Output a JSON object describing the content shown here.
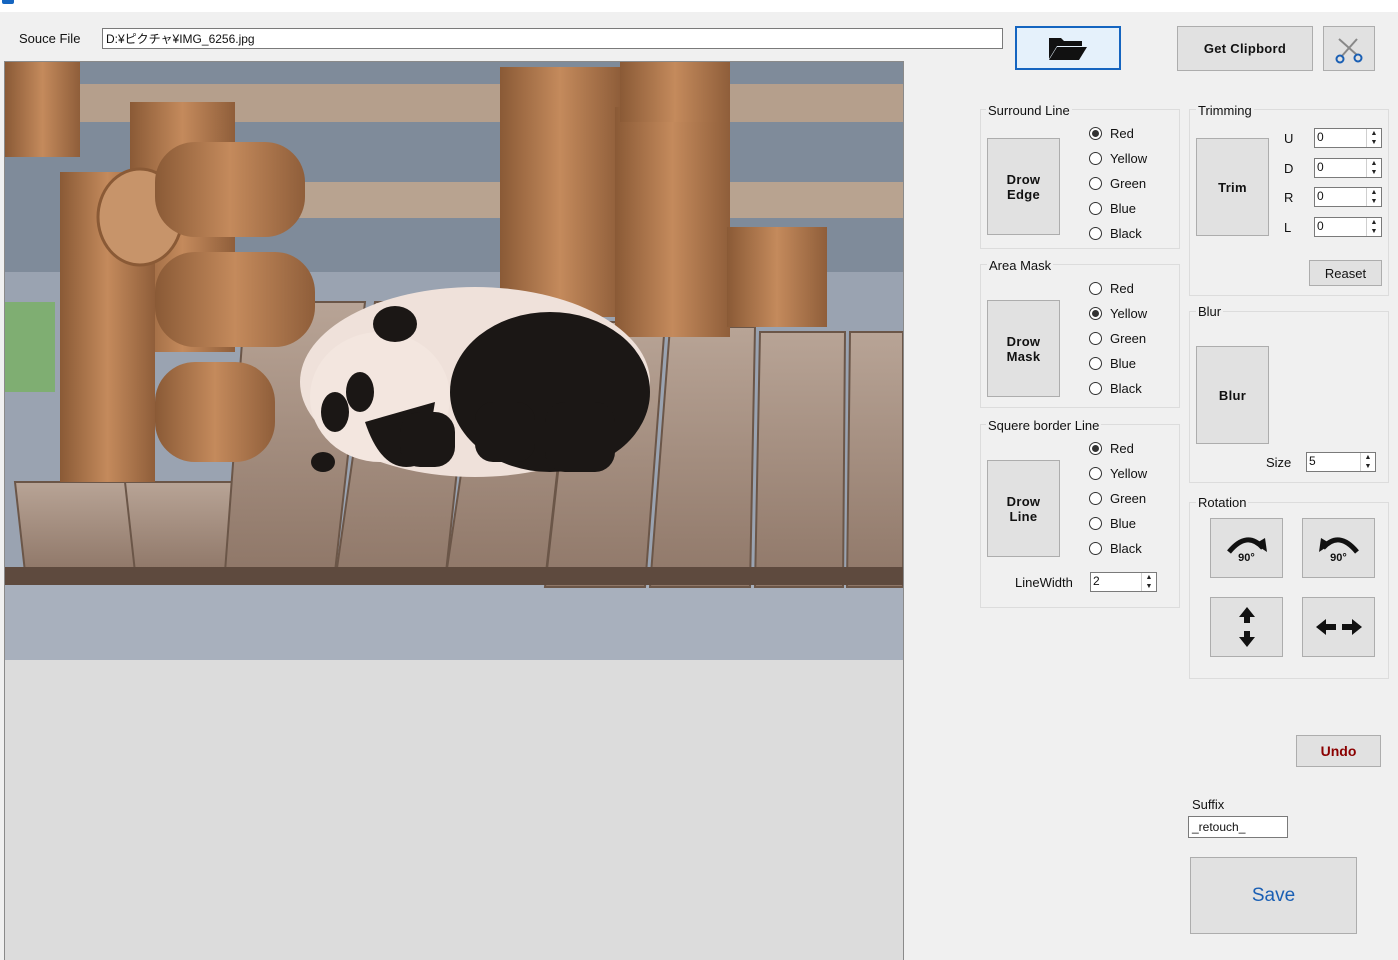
{
  "source": {
    "label": "Souce File",
    "path": "D:¥ピクチャ¥IMG_6256.jpg"
  },
  "toolbar": {
    "get_clipboard": "Get Clipbord"
  },
  "surround": {
    "title": "Surround Line",
    "button": "Drow\nEdge",
    "options": [
      "Red",
      "Yellow",
      "Green",
      "Blue",
      "Black"
    ],
    "selected": "Red"
  },
  "mask": {
    "title": "Area Mask",
    "button": "Drow\nMask",
    "options": [
      "Red",
      "Yellow",
      "Green",
      "Blue",
      "Black"
    ],
    "selected": "Yellow"
  },
  "square": {
    "title": "Squere border Line",
    "button": "Drow\nLine",
    "options": [
      "Red",
      "Yellow",
      "Green",
      "Blue",
      "Black"
    ],
    "selected": "Red",
    "linewidth_label": "LineWidth",
    "linewidth": "2"
  },
  "trimming": {
    "title": "Trimming",
    "button": "Trim",
    "fields": [
      {
        "label": "U",
        "value": "0"
      },
      {
        "label": "D",
        "value": "0"
      },
      {
        "label": "R",
        "value": "0"
      },
      {
        "label": "L",
        "value": "0"
      }
    ],
    "reset": "Reaset"
  },
  "blur": {
    "title": "Blur",
    "button": "Blur",
    "size_label": "Size",
    "size": "5"
  },
  "rotation": {
    "title": "Rotation",
    "cw": "90°",
    "ccw": "90°"
  },
  "undo": "Undo",
  "suffix": {
    "label": "Suffix",
    "value": "_retouch_"
  },
  "save": "Save",
  "colors": {
    "undo_text": "#8b0000",
    "save_text": "#1a5fb4",
    "accent_border": "#1565c0"
  },
  "icons": [
    "app-icon",
    "folder-open-icon",
    "scissors-icon",
    "rotate-cw-icon",
    "rotate-ccw-icon",
    "flip-vertical-icon",
    "flip-horizontal-icon"
  ]
}
